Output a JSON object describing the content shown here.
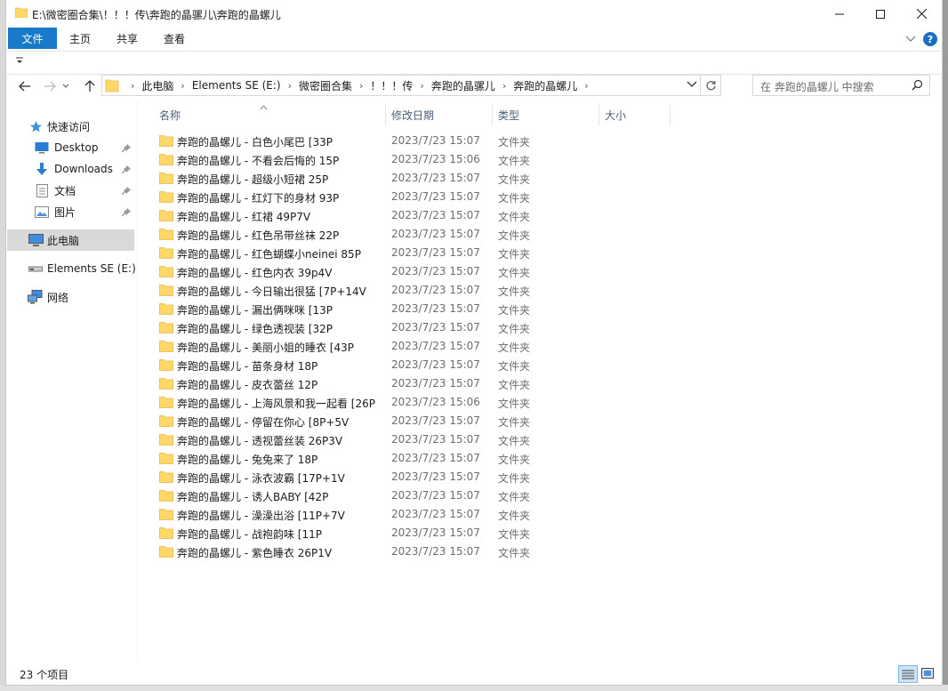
{
  "window": {
    "title": "E:\\微密圈合集\\！！！传\\奔跑的晶骡儿\\奔跑的晶螺儿"
  },
  "ribbon": {
    "tabs": [
      "文件",
      "主页",
      "共享",
      "查看"
    ],
    "help": "?"
  },
  "nav": {
    "breadcrumbs": [
      "此电脑",
      "Elements SE (E:)",
      "微密圈合集",
      "！！！传",
      "奔跑的晶骡儿",
      "奔跑的晶螺儿"
    ]
  },
  "search": {
    "placeholder": "在 奔跑的晶螺儿 中搜索"
  },
  "sidebar": {
    "items": [
      {
        "label": "快速访问",
        "icon": "star-icon"
      },
      {
        "label": "Desktop",
        "icon": "desktop-icon",
        "pinned": true
      },
      {
        "label": "Downloads",
        "icon": "download-arrow-icon",
        "pinned": true
      },
      {
        "label": "文档",
        "icon": "document-icon",
        "pinned": true
      },
      {
        "label": "图片",
        "icon": "picture-icon",
        "pinned": true
      },
      {
        "label": "此电脑",
        "icon": "computer-icon",
        "selected": true
      },
      {
        "label": "Elements SE (E:)",
        "icon": "drive-icon"
      },
      {
        "label": "网络",
        "icon": "network-icon"
      }
    ]
  },
  "columns": [
    "名称",
    "修改日期",
    "类型",
    "大小"
  ],
  "files": [
    {
      "name": "奔跑的晶螺儿 - 白色小尾巴 [33P",
      "date": "2023/7/23 15:07",
      "type": "文件夹"
    },
    {
      "name": "奔跑的晶螺儿 - 不看会后悔的 15P",
      "date": "2023/7/23 15:06",
      "type": "文件夹"
    },
    {
      "name": "奔跑的晶螺儿 - 超级小短裙 25P",
      "date": "2023/7/23 15:07",
      "type": "文件夹"
    },
    {
      "name": "奔跑的晶螺儿 - 红灯下的身材 93P",
      "date": "2023/7/23 15:07",
      "type": "文件夹"
    },
    {
      "name": "奔跑的晶螺儿 - 红裙 49P7V",
      "date": "2023/7/23 15:07",
      "type": "文件夹"
    },
    {
      "name": "奔跑的晶螺儿 - 红色吊带丝袜 22P",
      "date": "2023/7/23 15:07",
      "type": "文件夹"
    },
    {
      "name": "奔跑的晶螺儿 - 红色蝴蝶小neinei 85P",
      "date": "2023/7/23 15:07",
      "type": "文件夹"
    },
    {
      "name": "奔跑的晶螺儿 - 红色内衣 39p4V",
      "date": "2023/7/23 15:07",
      "type": "文件夹"
    },
    {
      "name": "奔跑的晶螺儿 - 今日输出很猛 [7P+14V",
      "date": "2023/7/23 15:07",
      "type": "文件夹"
    },
    {
      "name": "奔跑的晶螺儿 - 漏出俩咪咪 [13P",
      "date": "2023/7/23 15:07",
      "type": "文件夹"
    },
    {
      "name": "奔跑的晶螺儿 - 绿色透视装 [32P",
      "date": "2023/7/23 15:07",
      "type": "文件夹"
    },
    {
      "name": "奔跑的晶螺儿 - 美丽小姐的睡衣 [43P",
      "date": "2023/7/23 15:07",
      "type": "文件夹"
    },
    {
      "name": "奔跑的晶螺儿 - 苗条身材 18P",
      "date": "2023/7/23 15:07",
      "type": "文件夹"
    },
    {
      "name": "奔跑的晶螺儿 - 皮衣蕾丝 12P",
      "date": "2023/7/23 15:07",
      "type": "文件夹"
    },
    {
      "name": "奔跑的晶螺儿 - 上海风景和我一起看 [26P",
      "date": "2023/7/23 15:06",
      "type": "文件夹"
    },
    {
      "name": "奔跑的晶螺儿 - 停留在你心 [8P+5V",
      "date": "2023/7/23 15:07",
      "type": "文件夹"
    },
    {
      "name": "奔跑的晶螺儿 - 透视蕾丝装 26P3V",
      "date": "2023/7/23 15:07",
      "type": "文件夹"
    },
    {
      "name": "奔跑的晶螺儿 - 兔兔来了 18P",
      "date": "2023/7/23 15:07",
      "type": "文件夹"
    },
    {
      "name": "奔跑的晶螺儿 - 泳衣波霸 [17P+1V",
      "date": "2023/7/23 15:07",
      "type": "文件夹"
    },
    {
      "name": "奔跑的晶螺儿 - 诱人BABY [42P",
      "date": "2023/7/23 15:07",
      "type": "文件夹"
    },
    {
      "name": "奔跑的晶螺儿 - 澡澡出浴 [11P+7V",
      "date": "2023/7/23 15:07",
      "type": "文件夹"
    },
    {
      "name": "奔跑的晶螺儿 - 战袍韵味 [11P",
      "date": "2023/7/23 15:07",
      "type": "文件夹"
    },
    {
      "name": "奔跑的晶螺儿 - 紫色睡衣 26P1V",
      "date": "2023/7/23 15:07",
      "type": "文件夹"
    }
  ],
  "status": {
    "count": "23 个项目"
  },
  "colors": {
    "accent": "#1979ca",
    "folder": "#ffd867",
    "folder_dark": "#e8b64a",
    "selection": "#d9d9d9",
    "header_text": "#4c607a"
  }
}
